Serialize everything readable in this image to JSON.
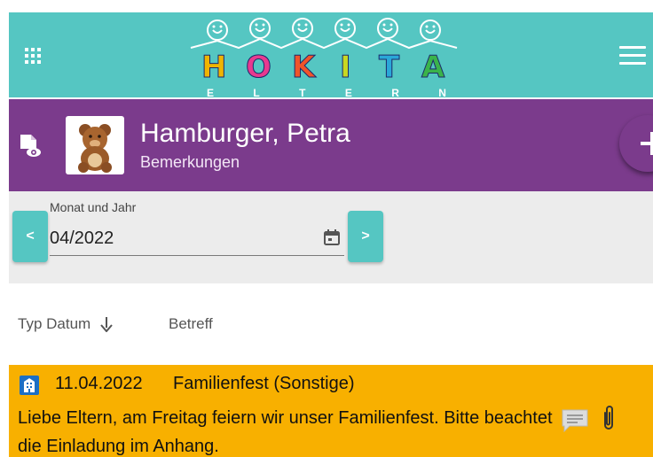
{
  "colors": {
    "teal": "#55c6c2",
    "purple": "#7b3b8c",
    "row_highlight": "#f8b000",
    "month_bg": "#ececec"
  },
  "topbar": {
    "apps_icon": "apps-grid-icon",
    "menu_icon": "hamburger-menu-icon",
    "logo": {
      "letters": [
        "H",
        "O",
        "K",
        "I",
        "T",
        "A"
      ],
      "subtitle_letters": [
        "E",
        "L",
        "T",
        "E",
        "R",
        "N"
      ]
    }
  },
  "header": {
    "doc_icon": "document-view-icon",
    "name": "Hamburger, Petra",
    "subtitle": "Bemerkungen",
    "avatar": "teddy-bear-avatar",
    "add_icon": "plus-icon"
  },
  "month_selector": {
    "prev_label": "<",
    "next_label": ">",
    "field_label": "Monat und Jahr",
    "value": "04/2022",
    "calendar_icon": "calendar-icon"
  },
  "table": {
    "columns": {
      "type_date": "Typ Datum",
      "subject": "Betreff"
    },
    "sort_icon": "arrow-down-icon"
  },
  "rows": [
    {
      "type_icon": "building-icon",
      "date": "11.04.2022",
      "subject": "Familienfest (Sonstige)",
      "text": "Liebe Eltern, am Freitag feiern wir unser Familienfest. Bitte beachtet die Einladung im Anhang.",
      "comment_icon": "comment-icon",
      "attachment_icon": "paperclip-icon"
    }
  ]
}
